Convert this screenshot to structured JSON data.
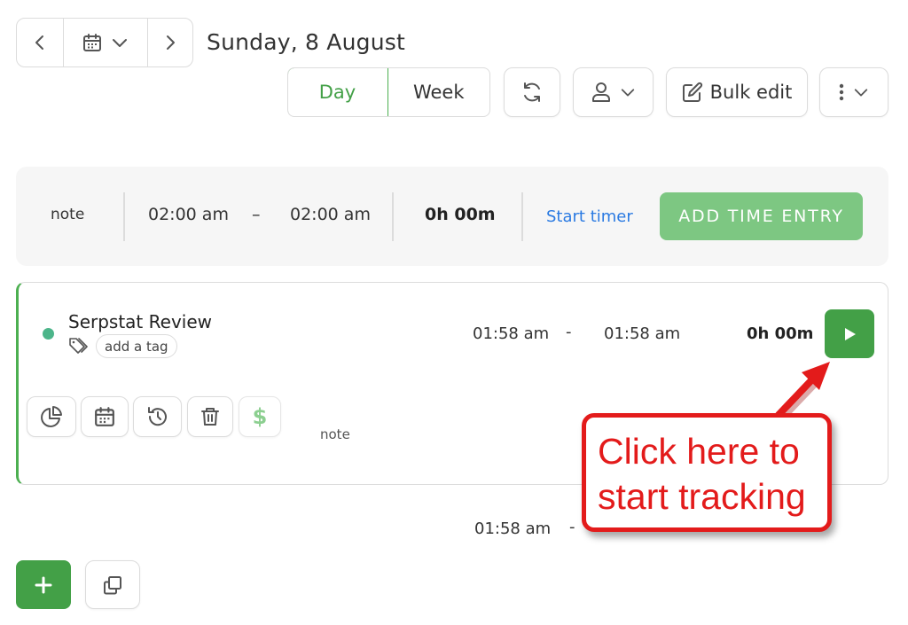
{
  "header": {
    "date_title": "Sunday, 8 August",
    "prev_icon": "chevron-left-icon",
    "next_icon": "chevron-right-icon",
    "calendar_icon": "calendar-icon"
  },
  "toolbar": {
    "day_label": "Day",
    "week_label": "Week",
    "refresh_icon": "refresh-icon",
    "user_icon": "user-icon",
    "bulk_edit_label": "Bulk edit",
    "more_icon": "kebab-icon",
    "active_view": "Day"
  },
  "entry_bar": {
    "note_label": "note",
    "start_time": "02:00 am",
    "separator": "–",
    "end_time": "02:00 am",
    "duration": "0h 00m",
    "start_timer_label": "Start timer",
    "add_entry_label": "ADD TIME ENTRY"
  },
  "entry_card": {
    "project_name": "Serpstat Review",
    "status_color": "#4cb58a",
    "tag_placeholder": "add a tag",
    "start_time": "01:58 am",
    "separator": "-",
    "end_time": "01:58 am",
    "duration": "0h 00m",
    "note_label": "note",
    "tools": [
      "pie-chart-icon",
      "calendar-icon",
      "history-icon",
      "trash-icon",
      "dollar-icon"
    ]
  },
  "partial_row": {
    "start_time": "01:58 am",
    "separator": "-"
  },
  "callout": {
    "line1": "Click here to",
    "line2": "start tracking"
  },
  "colors": {
    "accent_green": "#43a047",
    "light_green": "#7dc782",
    "link_blue": "#2a7ae2",
    "callout_red": "#e31b1b"
  }
}
